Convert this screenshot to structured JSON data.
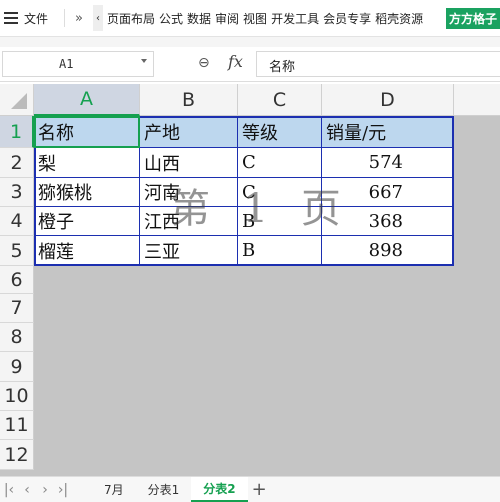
{
  "ribbon": {
    "file_label": "文件",
    "more_label": "»",
    "scroll_label": "‹",
    "tabs": [
      "页面布局",
      "公式",
      "数据",
      "审阅",
      "视图",
      "开发工具",
      "会员专享",
      "稻壳资源"
    ],
    "brand": "方方格子"
  },
  "formula_bar": {
    "cell_ref": "A1",
    "fx_label": "fx",
    "value": "名称"
  },
  "columns": [
    "A",
    "B",
    "C",
    "D"
  ],
  "rows": [
    "1",
    "2",
    "3",
    "4",
    "5",
    "6",
    "7",
    "8",
    "9",
    "10",
    "11",
    "12"
  ],
  "table": {
    "header": [
      "名称",
      "产地",
      "等级",
      "销量/元"
    ],
    "rows": [
      [
        "梨",
        "山西",
        "C",
        "574"
      ],
      [
        "猕猴桃",
        "河南",
        "C",
        "667"
      ],
      [
        "橙子",
        "江西",
        "B",
        "368"
      ],
      [
        "榴莲",
        "三亚",
        "B",
        "898"
      ]
    ]
  },
  "watermark": "第 1 页",
  "sheet_tabs": [
    "7月",
    "分表1",
    "分表2"
  ],
  "active_sheet": "分表2",
  "colors": {
    "accent": "#15a050",
    "header_fill": "#bdd7ee",
    "border": "#1c2fb0"
  }
}
